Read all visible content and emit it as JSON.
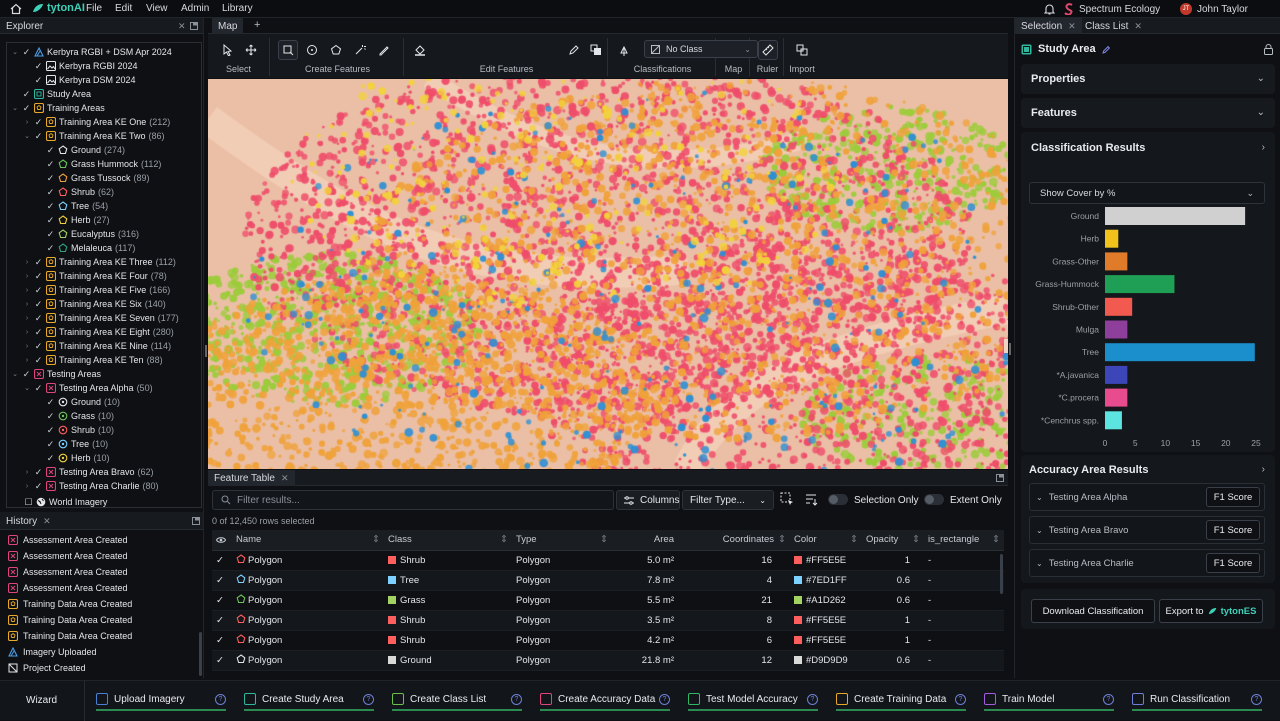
{
  "menubar": {
    "brand": "tytonAI",
    "items": [
      "File",
      "Edit",
      "View",
      "Admin",
      "Library"
    ],
    "organisation": "Spectrum Ecology",
    "user_initials": "JT",
    "user_name": "John Taylor"
  },
  "explorer": {
    "title": "Explorer",
    "tree": [
      {
        "label": "Kerbyra RGBI + DSM Apr 2024",
        "count": "",
        "icon": "imagery-group-icon",
        "level": 0,
        "expand": "open"
      },
      {
        "label": "Kerbyra RGBI 2024",
        "count": "",
        "icon": "image-layer-icon",
        "level": 1,
        "expand": ""
      },
      {
        "label": "Kerbyra DSM 2024",
        "count": "",
        "icon": "image-layer-icon",
        "level": 1,
        "expand": ""
      },
      {
        "label": "Study Area",
        "count": "",
        "icon": "study-area-icon",
        "level": 0,
        "expand": ""
      },
      {
        "label": "Training Areas",
        "count": "",
        "icon": "training-area-icon",
        "level": 0,
        "expand": "open"
      },
      {
        "label": "Training Area KE One",
        "count": "(212)",
        "icon": "training-area-icon",
        "level": 1,
        "expand": "closed"
      },
      {
        "label": "Training Area KE Two",
        "count": "(86)",
        "icon": "training-area-icon",
        "level": 1,
        "expand": "open"
      },
      {
        "label": "Ground",
        "count": "(274)",
        "icon": "pentagon-white-icon",
        "level": 2,
        "expand": ""
      },
      {
        "label": "Grass Hummock",
        "count": "(112)",
        "icon": "pentagon-green-icon",
        "level": 2,
        "expand": ""
      },
      {
        "label": "Grass Tussock",
        "count": "(89)",
        "icon": "pentagon-orange-icon",
        "level": 2,
        "expand": ""
      },
      {
        "label": "Shrub",
        "count": "(62)",
        "icon": "pentagon-red-icon",
        "level": 2,
        "expand": ""
      },
      {
        "label": "Tree",
        "count": "(54)",
        "icon": "pentagon-blue-icon",
        "level": 2,
        "expand": ""
      },
      {
        "label": "Herb",
        "count": "(27)",
        "icon": "pentagon-yellow-icon",
        "level": 2,
        "expand": ""
      },
      {
        "label": "Eucalyptus",
        "count": "(316)",
        "icon": "pentagon-lime-icon",
        "level": 2,
        "expand": ""
      },
      {
        "label": "Melaleuca",
        "count": "(117)",
        "icon": "pentagon-teal-icon",
        "level": 2,
        "expand": ""
      },
      {
        "label": "Training Area KE Three",
        "count": "(112)",
        "icon": "training-area-icon",
        "level": 1,
        "expand": "closed"
      },
      {
        "label": "Training Area KE Four",
        "count": "(78)",
        "icon": "training-area-icon",
        "level": 1,
        "expand": "closed"
      },
      {
        "label": "Training Area KE Five",
        "count": "(166)",
        "icon": "training-area-icon",
        "level": 1,
        "expand": "closed"
      },
      {
        "label": "Training Area KE Six",
        "count": "(140)",
        "icon": "training-area-icon",
        "level": 1,
        "expand": "closed"
      },
      {
        "label": "Training Area KE Seven",
        "count": "(177)",
        "icon": "training-area-icon",
        "level": 1,
        "expand": "closed"
      },
      {
        "label": "Training Area KE Eight",
        "count": "(280)",
        "icon": "training-area-icon",
        "level": 1,
        "expand": "closed"
      },
      {
        "label": "Training Area KE Nine",
        "count": "(114)",
        "icon": "training-area-icon",
        "level": 1,
        "expand": "closed"
      },
      {
        "label": "Training Area KE Ten",
        "count": "(88)",
        "icon": "training-area-icon",
        "level": 1,
        "expand": "closed"
      },
      {
        "label": "Testing Areas",
        "count": "",
        "icon": "testing-area-icon",
        "level": 0,
        "expand": "open"
      },
      {
        "label": "Testing Area Alpha",
        "count": "(50)",
        "icon": "testing-area-icon",
        "level": 1,
        "expand": "open"
      },
      {
        "label": "Ground",
        "count": "(10)",
        "icon": "circle-white-icon",
        "level": 2,
        "expand": ""
      },
      {
        "label": "Grass",
        "count": "(10)",
        "icon": "circle-green-icon",
        "level": 2,
        "expand": ""
      },
      {
        "label": "Shrub",
        "count": "(10)",
        "icon": "circle-red-icon",
        "level": 2,
        "expand": ""
      },
      {
        "label": "Tree",
        "count": "(10)",
        "icon": "circle-blue-icon",
        "level": 2,
        "expand": ""
      },
      {
        "label": "Herb",
        "count": "(10)",
        "icon": "circle-yellow-icon",
        "level": 2,
        "expand": ""
      },
      {
        "label": "Testing Area Bravo",
        "count": "(62)",
        "icon": "testing-area-icon",
        "level": 1,
        "expand": "closed"
      },
      {
        "label": "Testing Area Charlie",
        "count": "(80)",
        "icon": "testing-area-icon",
        "level": 1,
        "expand": "closed"
      }
    ],
    "basemap": "World Imagery"
  },
  "history": {
    "title": "History",
    "items": [
      {
        "label": "Assessment Area Created",
        "icon": "testing-area-icon"
      },
      {
        "label": "Assessment Area Created",
        "icon": "testing-area-icon"
      },
      {
        "label": "Assessment Area Created",
        "icon": "testing-area-icon"
      },
      {
        "label": "Assessment Area Created",
        "icon": "testing-area-icon"
      },
      {
        "label": "Training Data Area Created",
        "icon": "training-area-icon"
      },
      {
        "label": "Training Data Area Created",
        "icon": "training-area-icon"
      },
      {
        "label": "Training Data Area Created",
        "icon": "training-area-icon"
      },
      {
        "label": "Imagery Uploaded",
        "icon": "imagery-group-icon"
      },
      {
        "label": "Project Created",
        "icon": "project-icon"
      }
    ]
  },
  "map_tab": {
    "label": "Map",
    "add": "+"
  },
  "toolbar": {
    "groups": [
      {
        "label": "Select"
      },
      {
        "label": "Create Features"
      },
      {
        "label": "Edit Features"
      },
      {
        "label": "Classifications"
      },
      {
        "label": "Map"
      },
      {
        "label": "Ruler"
      },
      {
        "label": "Import"
      }
    ],
    "class_select": "No Class"
  },
  "feature_table": {
    "title": "Feature Table",
    "filter_placeholder": "Filter results...",
    "columns_btn": "Columns",
    "filter_type": "Filter Type...",
    "selection_only": "Selection Only",
    "extent_only": "Extent Only",
    "rows_selected": "0 of 12,450 rows selected",
    "headers": [
      "Name",
      "Class",
      "Type",
      "Area",
      "Coordinates",
      "Color",
      "Opacity",
      "is_rectangle"
    ],
    "rows": [
      {
        "name": "Polygon",
        "icon": "pentagon-red-icon",
        "class": "Shrub",
        "class_color": "#FF5E5E",
        "type": "Polygon",
        "area": "5.0 m²",
        "coords": "16",
        "color": "#FF5E5E",
        "opacity": "1",
        "rect": "-"
      },
      {
        "name": "Polygon",
        "icon": "pentagon-blue-icon",
        "class": "Tree",
        "class_color": "#7ED1FF",
        "type": "Polygon",
        "area": "7.8 m²",
        "coords": "4",
        "color": "#7ED1FF",
        "opacity": "0.6",
        "rect": "-"
      },
      {
        "name": "Polygon",
        "icon": "pentagon-green-icon",
        "class": "Grass",
        "class_color": "#A1D262",
        "type": "Polygon",
        "area": "5.5 m²",
        "coords": "21",
        "color": "#A1D262",
        "opacity": "0.6",
        "rect": "-"
      },
      {
        "name": "Polygon",
        "icon": "pentagon-red-icon",
        "class": "Shrub",
        "class_color": "#FF5E5E",
        "type": "Polygon",
        "area": "3.5 m²",
        "coords": "8",
        "color": "#FF5E5E",
        "opacity": "1",
        "rect": "-"
      },
      {
        "name": "Polygon",
        "icon": "pentagon-red-icon",
        "class": "Shrub",
        "class_color": "#FF5E5E",
        "type": "Polygon",
        "area": "4.2 m²",
        "coords": "6",
        "color": "#FF5E5E",
        "opacity": "1",
        "rect": "-"
      },
      {
        "name": "Polygon",
        "icon": "pentagon-white-icon",
        "class": "Ground",
        "class_color": "#D9D9D9",
        "type": "Polygon",
        "area": "21.8 m²",
        "coords": "12",
        "color": "#D9D9D9",
        "opacity": "0.6",
        "rect": "-"
      }
    ]
  },
  "right_panel": {
    "tabs": [
      "Selection",
      "Class List"
    ],
    "title": "Study Area",
    "properties": "Properties",
    "features": "Features",
    "classification_results": "Classification Results",
    "cover_select": "Show Cover by %",
    "accuracy_title": "Accuracy Area Results",
    "accuracy_rows": [
      {
        "label": "Testing Area Alpha",
        "btn": "F1 Score"
      },
      {
        "label": "Testing Area Bravo",
        "btn": "F1 Score"
      },
      {
        "label": "Testing Area Charlie",
        "btn": "F1 Score"
      }
    ],
    "download_btn": "Download Classification",
    "export_btn": "Export to",
    "export_brand": "tytonES"
  },
  "chart_data": {
    "type": "bar",
    "orientation": "horizontal",
    "categories": [
      "Ground",
      "Herb",
      "Grass-Other",
      "Grass-Hummock",
      "Shrub-Other",
      "Mulga",
      "Tree",
      "*A.javanica",
      "*C.procera",
      "*Cenchrus spp."
    ],
    "values": [
      23.2,
      2.2,
      3.7,
      11.5,
      4.5,
      3.7,
      24.8,
      3.7,
      3.7,
      2.8
    ],
    "colors": [
      "#D0D0D0",
      "#F2C21B",
      "#E07B2A",
      "#1F9E55",
      "#F25A4F",
      "#8E3E9B",
      "#1A8FCC",
      "#3D46B8",
      "#E84C8E",
      "#5CE5E0"
    ],
    "xlim": [
      0,
      25
    ],
    "xticks": [
      0,
      5,
      10,
      15,
      20,
      25
    ],
    "grid": false
  },
  "wizard": {
    "title": "Wizard",
    "steps": [
      {
        "label": "Upload Imagery",
        "icon": "upload-icon",
        "color": "#4a7fd6"
      },
      {
        "label": "Create Study Area",
        "icon": "study-area-icon",
        "color": "#2fb89e"
      },
      {
        "label": "Create Class List",
        "icon": "class-list-icon",
        "color": "#6bbf4a"
      },
      {
        "label": "Create Accuracy Data",
        "icon": "testing-area-icon",
        "color": "#e0457a"
      },
      {
        "label": "Test Model Accuracy",
        "icon": "crosshair-icon",
        "color": "#2fb866"
      },
      {
        "label": "Create Training Data",
        "icon": "training-area-icon",
        "color": "#e8a82a"
      },
      {
        "label": "Train Model",
        "icon": "model-icon",
        "color": "#a45be0"
      },
      {
        "label": "Run Classification",
        "icon": "classify-icon",
        "color": "#6f7fd8"
      }
    ]
  }
}
